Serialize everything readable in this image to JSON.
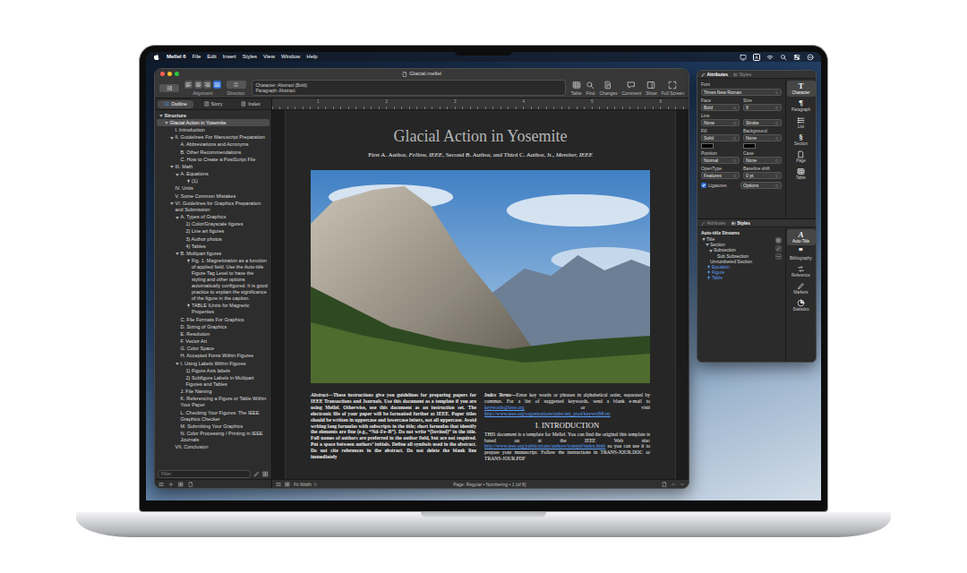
{
  "menubar": {
    "app": "Mellel 6",
    "menus": [
      "File",
      "Edit",
      "Insert",
      "Styles",
      "View",
      "Window",
      "Help"
    ],
    "input_source": "A"
  },
  "window": {
    "title": "Glacial.mellel"
  },
  "toolbar": {
    "alignment": {
      "label": "Alignment",
      "buttons": [
        {
          "selected": false
        },
        {
          "selected": false
        },
        {
          "selected": false
        },
        {
          "selected": true
        }
      ]
    },
    "direction": {
      "label": "Direction"
    },
    "style_field": {
      "character": "Character: Abstract (Bold)",
      "paragraph": "Paragraph: Abstract"
    },
    "tools": [
      "Table",
      "Find",
      "Changes",
      "Comment",
      "Show",
      "Full Screen"
    ]
  },
  "sidebar": {
    "tabs": [
      {
        "label": "Outline",
        "selected": true
      },
      {
        "label": "Story",
        "selected": false
      },
      {
        "label": "Index",
        "selected": false
      }
    ],
    "outline": {
      "label": "Structure",
      "expanded": true,
      "children": [
        {
          "label": "Glacial Action in Yosemite",
          "kind": "heading",
          "selected": true,
          "expanded": true,
          "children": [
            {
              "label": "I. Introduction",
              "kind": "heading",
              "selected": false
            },
            {
              "label": "II. Guidelines For Manuscript Preparation",
              "kind": "heading",
              "selected": false,
              "expanded": true,
              "children": [
                {
                  "label": "A. Abbreviations and Acronyms",
                  "kind": "heading",
                  "selected": false
                },
                {
                  "label": "B. Other Recommendations",
                  "kind": "heading",
                  "selected": false
                },
                {
                  "label": "C. How to Create a PostScript File",
                  "kind": "heading",
                  "selected": false
                }
              ]
            },
            {
              "label": "III. Math",
              "kind": "heading",
              "selected": false,
              "expanded": true,
              "children": [
                {
                  "label": "A. Equations",
                  "kind": "heading",
                  "selected": false,
                  "expanded": true,
                  "children": [
                    {
                      "label": "(1)",
                      "kind": "equation",
                      "selected": false
                    }
                  ]
                }
              ]
            },
            {
              "label": "IV. Units",
              "kind": "heading",
              "selected": false
            },
            {
              "label": "V. Some Common Mistakes",
              "kind": "heading",
              "selected": false
            },
            {
              "label": "VI. Guidelines for Graphics Preparation and Submission",
              "kind": "heading",
              "selected": false,
              "expanded": true,
              "children": [
                {
                  "label": "A. Types of Graphics",
                  "kind": "heading",
                  "selected": false,
                  "expanded": true,
                  "children": [
                    {
                      "label": "1) Color/Grayscale figures",
                      "kind": "heading",
                      "selected": false
                    },
                    {
                      "label": "2) Line art figures",
                      "kind": "heading",
                      "selected": false
                    },
                    {
                      "label": "3) Author photos",
                      "kind": "heading",
                      "selected": false
                    },
                    {
                      "label": "4) Tables",
                      "kind": "heading",
                      "selected": false
                    }
                  ]
                },
                {
                  "label": "B. Multipart figures",
                  "kind": "heading",
                  "selected": false,
                  "expanded": true,
                  "children": [
                    {
                      "label": "Fig. 1.  Magnetization as a function of applied field. Use the Auto-title Figure Tag Level to have the styling and other options automatically configured. It is good practice to explain the significance of the figure in the caption.",
                      "kind": "figure",
                      "selected": false
                    },
                    {
                      "label": "TABLE IUnits for Magnetic Properties",
                      "kind": "table",
                      "selected": false
                    }
                  ]
                },
                {
                  "label": "C. File Formats For Graphics",
                  "kind": "heading",
                  "selected": false
                },
                {
                  "label": "D. Sizing of Graphics",
                  "kind": "heading",
                  "selected": false
                },
                {
                  "label": "E. Resolution",
                  "kind": "heading",
                  "selected": false
                },
                {
                  "label": "F. Vector Art",
                  "kind": "heading",
                  "selected": false
                },
                {
                  "label": "G. Color Space",
                  "kind": "heading",
                  "selected": false
                },
                {
                  "label": "H. Accepted Fonts Within Figures",
                  "kind": "heading",
                  "selected": false
                },
                {
                  "label": "I. Using Labels Within Figures",
                  "kind": "heading",
                  "selected": false,
                  "expanded": true,
                  "children": [
                    {
                      "label": "1) Figure Axis labels",
                      "kind": "heading",
                      "selected": false
                    },
                    {
                      "label": "2) Subfigure Labels in Multipart Figures and Tables",
                      "kind": "heading",
                      "selected": false
                    }
                  ]
                },
                {
                  "label": "J. File Naming",
                  "kind": "heading",
                  "selected": false
                },
                {
                  "label": "K. Referencing a Figure or Table Within Your Paper",
                  "kind": "heading",
                  "selected": false
                },
                {
                  "label": "L. Checking Your Figures: The IEEE Graphics Checker",
                  "kind": "heading",
                  "selected": false
                },
                {
                  "label": "M. Submitting Your Graphics",
                  "kind": "heading",
                  "selected": false
                },
                {
                  "label": "N. Color Processing / Printing in IEEE Journals",
                  "kind": "heading",
                  "selected": false
                }
              ]
            },
            {
              "label": "VII. Conclusion",
              "kind": "heading",
              "selected": false
            }
          ]
        }
      ]
    },
    "filter": {
      "placeholder": "Filter"
    }
  },
  "ruler": {
    "ticks": [
      "1",
      "2",
      "3",
      "4",
      "5",
      "6"
    ]
  },
  "document": {
    "title": "Glacial Action in Yosemite",
    "authors": [
      {
        "text": "First A. Author, ",
        "kind": "plain"
      },
      {
        "text": "Fellow, IEEE",
        "kind": "italic"
      },
      {
        "text": ", Second B. Author, and Third C. Author, Jr., ",
        "kind": "plain"
      },
      {
        "text": "Member, IEEE",
        "kind": "italic"
      }
    ],
    "abstract": [
      {
        "text": "Abstract—",
        "kind": "lead"
      },
      {
        "text": "These instructions give you guidelines for preparing papers for IEEE Transactions and Journals. Use this document as a template if you are using Mellel. Otherwise, use this document as an instruction set. The electronic file of your paper will be formatted further at IEEE. Paper titles should be written in uppercase and lowercase letters, not all uppercase. Avoid writing long formulas with subscripts in the title; short formulas that identify the elements are fine (e.g., “Nd–Fe–B”). Do not write “(Invited)” in the title. Full names of authors are preferred in the author field, but are not required. Put a space between authors’ initials. Define all symbols used in the abstract. Do not cite references in the abstract. Do not delete the blank line immediately",
        "kind": "plain"
      }
    ],
    "index_terms": [
      {
        "text": "Index Terms—",
        "kind": "lead"
      },
      {
        "text": "Enter key words or phrases in alphabetical order, separated by commas. For a list of suggested keywords, send a blank e-mail to ",
        "kind": "plain"
      },
      {
        "text": "keywords@ieee.org",
        "kind": "link"
      },
      {
        "text": " or visit ",
        "kind": "plain"
      },
      {
        "text": "http://www.ieee.org/organizations/pubs/ani_prod/keywrd98.txt",
        "kind": "link"
      }
    ],
    "heading": "I. INTRODUCTION",
    "intro": [
      {
        "text": "THIS document is a template for Mellel. You can find the original this template is based on at the IEEE Web site: ",
        "kind": "plain"
      },
      {
        "text": "http://www.ieee.org/publications/authors/transjnl/index.html",
        "kind": "link"
      },
      {
        "text": " so you can use it to prepare your manuscript. Follow the instructions in TRANS-JOUR.DOC or TRANS-JOUR.PDF",
        "kind": "plain"
      }
    ]
  },
  "status_bar": {
    "zoom": "Fit Width",
    "page": "Page: Regular • Numbering • 1 (of 8)"
  },
  "inspector": {
    "tabs": [
      {
        "label": "Attributes",
        "selected": true
      },
      {
        "label": "Styles",
        "selected": false
      }
    ],
    "font": {
      "label": "Font",
      "value": "Times New Roman"
    },
    "rows": [
      [
        {
          "label": "Face",
          "value": "Bold",
          "kind": "select"
        },
        {
          "label": "Size",
          "value": "9",
          "kind": "stepper"
        }
      ],
      [
        {
          "label": "Line",
          "value": "None",
          "kind": "select"
        },
        {
          "value": "Stroke",
          "kind": "select"
        }
      ],
      [
        {
          "label": "Fill",
          "value": "Solid",
          "kind": "swatch-select"
        },
        {
          "label": "Background",
          "value": "None",
          "kind": "swatch-select"
        }
      ],
      [
        {
          "label": "Position",
          "value": "Normal",
          "kind": "select"
        },
        {
          "label": "Case",
          "value": "None",
          "kind": "select"
        }
      ],
      [
        {
          "label": "OpenType",
          "value": "Features",
          "kind": "select"
        },
        {
          "label": "Baseline shift",
          "value": "0 pt",
          "kind": "stepper"
        }
      ]
    ],
    "ligatures": {
      "label": "Ligatures",
      "checked": true
    },
    "options": "Options",
    "categories": [
      {
        "glyph": "T",
        "label": "Character",
        "selected": true
      },
      {
        "glyph": "¶",
        "label": "Paragraph",
        "selected": false
      },
      {
        "label": "List",
        "selected": false
      },
      {
        "glyph": "§",
        "label": "Section",
        "selected": false
      },
      {
        "label": "Page",
        "selected": false
      },
      {
        "label": "Table",
        "selected": false
      }
    ]
  },
  "styles_panel": {
    "tabs": [
      {
        "label": "Attributes",
        "selected": false
      },
      {
        "label": "Styles",
        "selected": true
      }
    ],
    "streams": {
      "title": "Auto-title Streams",
      "items": [
        {
          "label": "Title",
          "kind": "heading",
          "expanded": true,
          "children": [
            {
              "label": "Section",
              "kind": "heading",
              "expanded": true,
              "children": [
                {
                  "label": "Subsection",
                  "kind": "heading",
                  "expanded": true,
                  "children": [
                    {
                      "label": "Sub Subsection",
                      "kind": "heading"
                    }
                  ]
                }
              ]
            },
            {
              "label": "Unnumbered Section",
              "kind": "heading"
            }
          ]
        },
        {
          "label": "Equation",
          "kind": "object"
        },
        {
          "label": "Figure",
          "kind": "object"
        },
        {
          "label": "Table",
          "kind": "object"
        }
      ]
    },
    "categories": [
      {
        "glyph": "A",
        "label": "Auto-Title",
        "selected": true
      },
      {
        "glyph": "❞",
        "label": "Bibliography",
        "selected": false
      },
      {
        "label": "Reference",
        "selected": false
      },
      {
        "label": "Markers",
        "selected": false
      },
      {
        "label": "Statistics",
        "selected": false
      }
    ]
  }
}
